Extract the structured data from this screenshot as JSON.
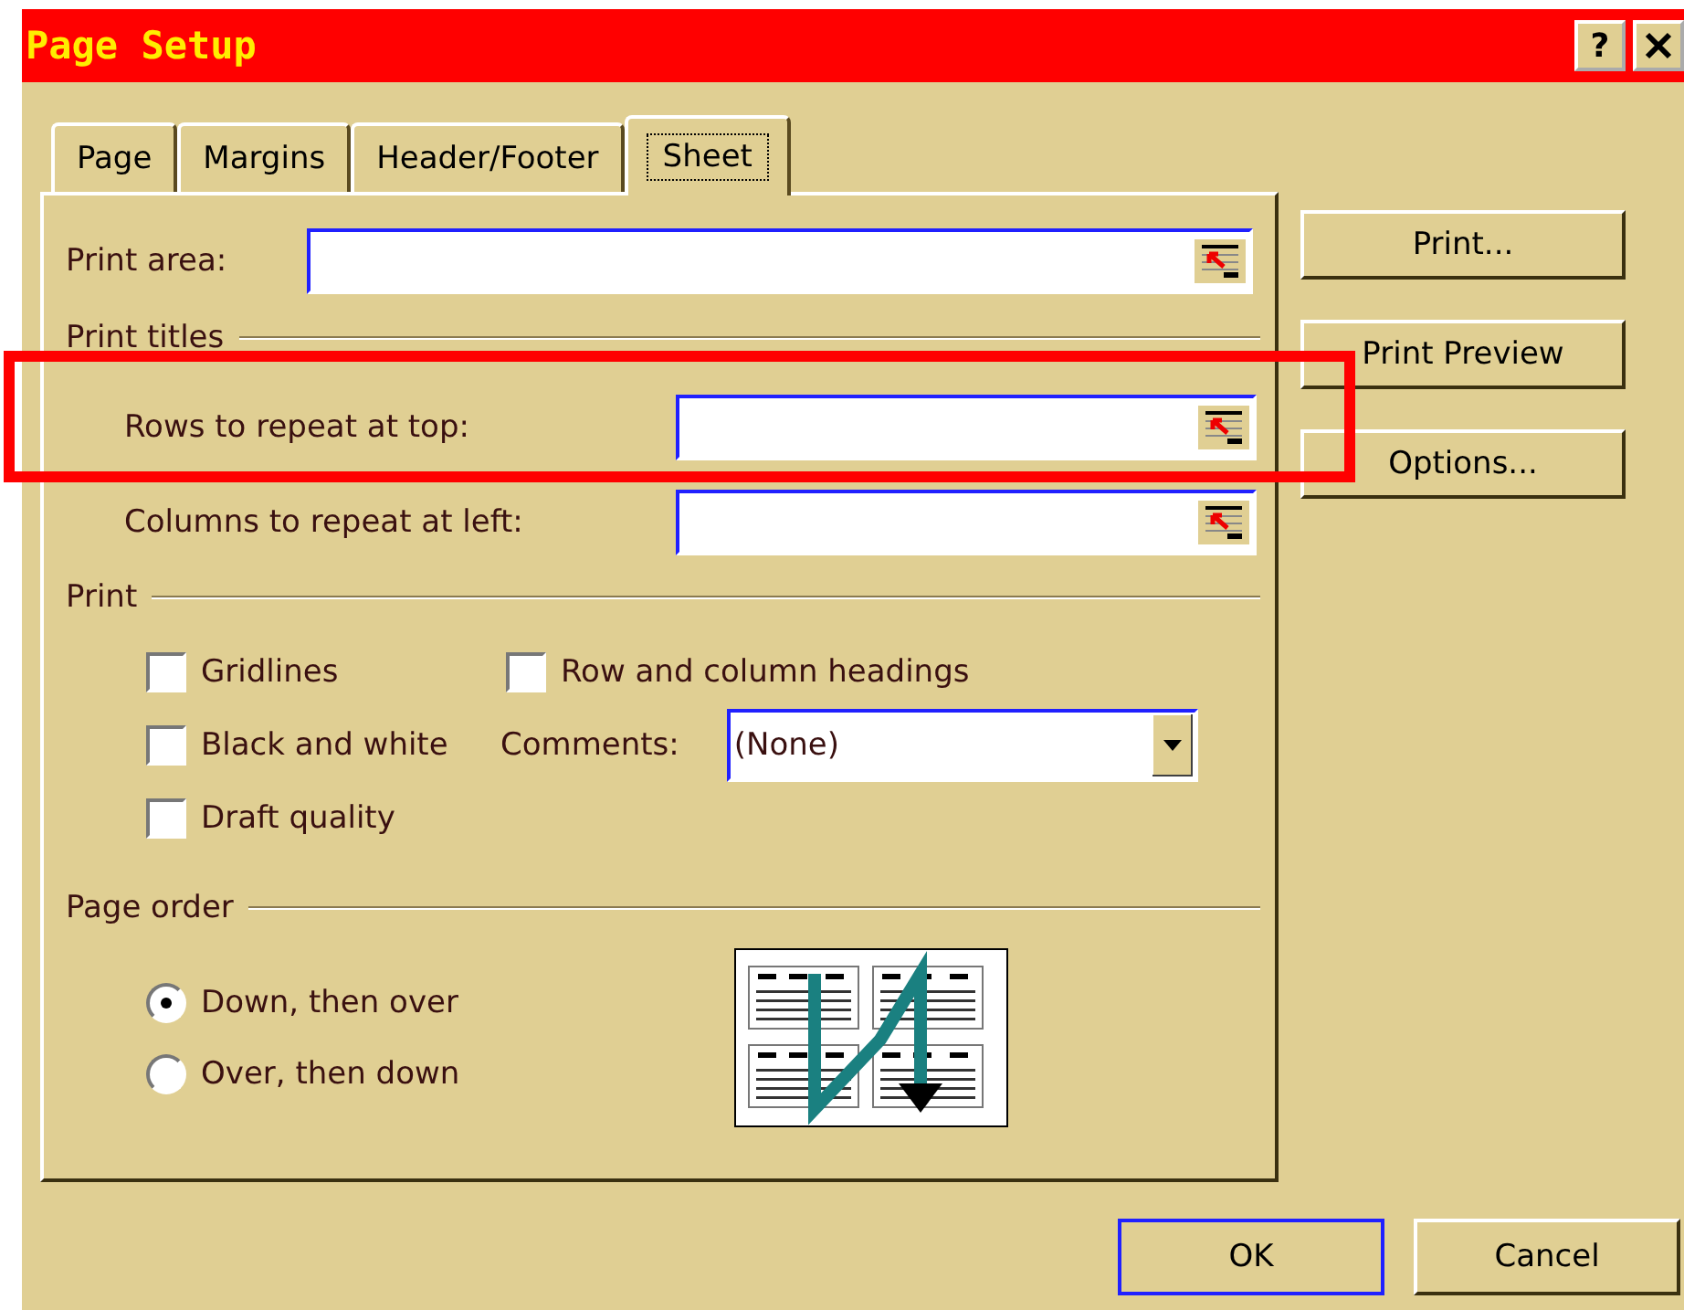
{
  "window": {
    "title": "Page Setup",
    "help_button": "?"
  },
  "tabs": [
    {
      "label": "Page",
      "selected": false
    },
    {
      "label": "Margins",
      "selected": false
    },
    {
      "label": "Header/Footer",
      "selected": false
    },
    {
      "label": "Sheet",
      "selected": true
    }
  ],
  "print_area": {
    "label": "Print area:"
  },
  "print_titles": {
    "heading": "Print titles",
    "fields": [
      {
        "label": "Rows to repeat at top:"
      },
      {
        "label": "Columns to repeat at left:"
      }
    ]
  },
  "print": {
    "heading": "Print",
    "checkboxes": [
      {
        "label": "Gridlines",
        "checked": false
      },
      {
        "label": "Black and white",
        "checked": false
      },
      {
        "label": "Draft quality",
        "checked": false
      }
    ],
    "headings_checkbox": {
      "label": "Row and column headings",
      "checked": false
    },
    "comments": {
      "label": "Comments:",
      "value": "(None)"
    }
  },
  "page_order": {
    "heading": "Page order",
    "options": [
      {
        "label": "Down, then over",
        "selected": true
      },
      {
        "label": "Over, then down",
        "selected": false
      }
    ]
  },
  "side_buttons": [
    "Print...",
    "Print Preview",
    "Options..."
  ],
  "footer_buttons": [
    {
      "label": "OK",
      "default": true
    },
    {
      "label": "Cancel",
      "default": false
    }
  ]
}
